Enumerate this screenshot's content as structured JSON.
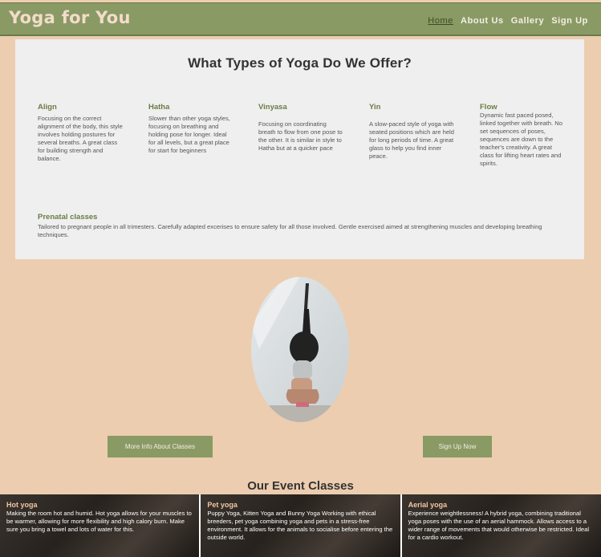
{
  "header": {
    "brand": "Yoga for You",
    "nav": [
      "Home",
      "About Us",
      "Gallery",
      "Sign Up"
    ]
  },
  "types": {
    "title": "What Types of Yoga Do We Offer?",
    "items": [
      {
        "name": "Align",
        "text": "Focusing on the correct alignment of the body, this style involves holding postures for several breaths. A great class for building strength and balance."
      },
      {
        "name": "Hatha",
        "text": "Slower than other yoga styles, focusing on breathing and holding pose for longer. Ideal for all levels, but a great place for start for beginners"
      },
      {
        "name": "Vinyasa",
        "text": "Focusing on coordinating breath to flow from one pose to the other. It is similar in style to Hatha but at a quicker pace"
      },
      {
        "name": "Yin",
        "text": "A slow-paced style of yoga with seated positions which are held for long periods of time. A great glass to help you find inner peace."
      },
      {
        "name": "Flow",
        "text": "Dynamic fast paced posed, linked together with breath. No set sequences of poses, sequences are down to the teacher's creativity. A great class for lifting heart rates and spirits."
      }
    ],
    "prenatal": {
      "name": "Prenatal classes",
      "text": "Tailored to pregnant people in all trimesters. Carefully adapted excerises to ensure safety for all those involved. Gentle exercised aimed at strengthening muscles and developing breathing techniques."
    }
  },
  "buttons": {
    "more_info": "More Info About Classes",
    "sign_up": "Sign Up Now"
  },
  "events": {
    "title": "Our Event Classes",
    "items": [
      {
        "name": "Hot yoga",
        "text": "Making the room hot and humid. Hot yoga allows for your muscles to be warmer, allowing for more flexibility and high calory burn. Make sure you bring a towel and lots of water for this."
      },
      {
        "name": "Pet yoga",
        "text": "Puppy Yoga, Kitten Yoga and Bunny Yoga Working with ethical breeders, pet yoga combining yoga and pets in a stress-free environment. It allows for the animals to socialise before entering the outside world."
      },
      {
        "name": "Aerial yoga",
        "text": "Experience weightlessness! A hybrid yoga, combining traditional yoga poses with the use of an aerial hammock. Allows access to a wider range of movements that would otherwise be restricted. Ideal for a cardio workout."
      }
    ]
  },
  "colors": {
    "background": "#eccdb0",
    "header": "#8a9a64",
    "accent_text": "#6b7c45",
    "panel": "#efefef"
  }
}
